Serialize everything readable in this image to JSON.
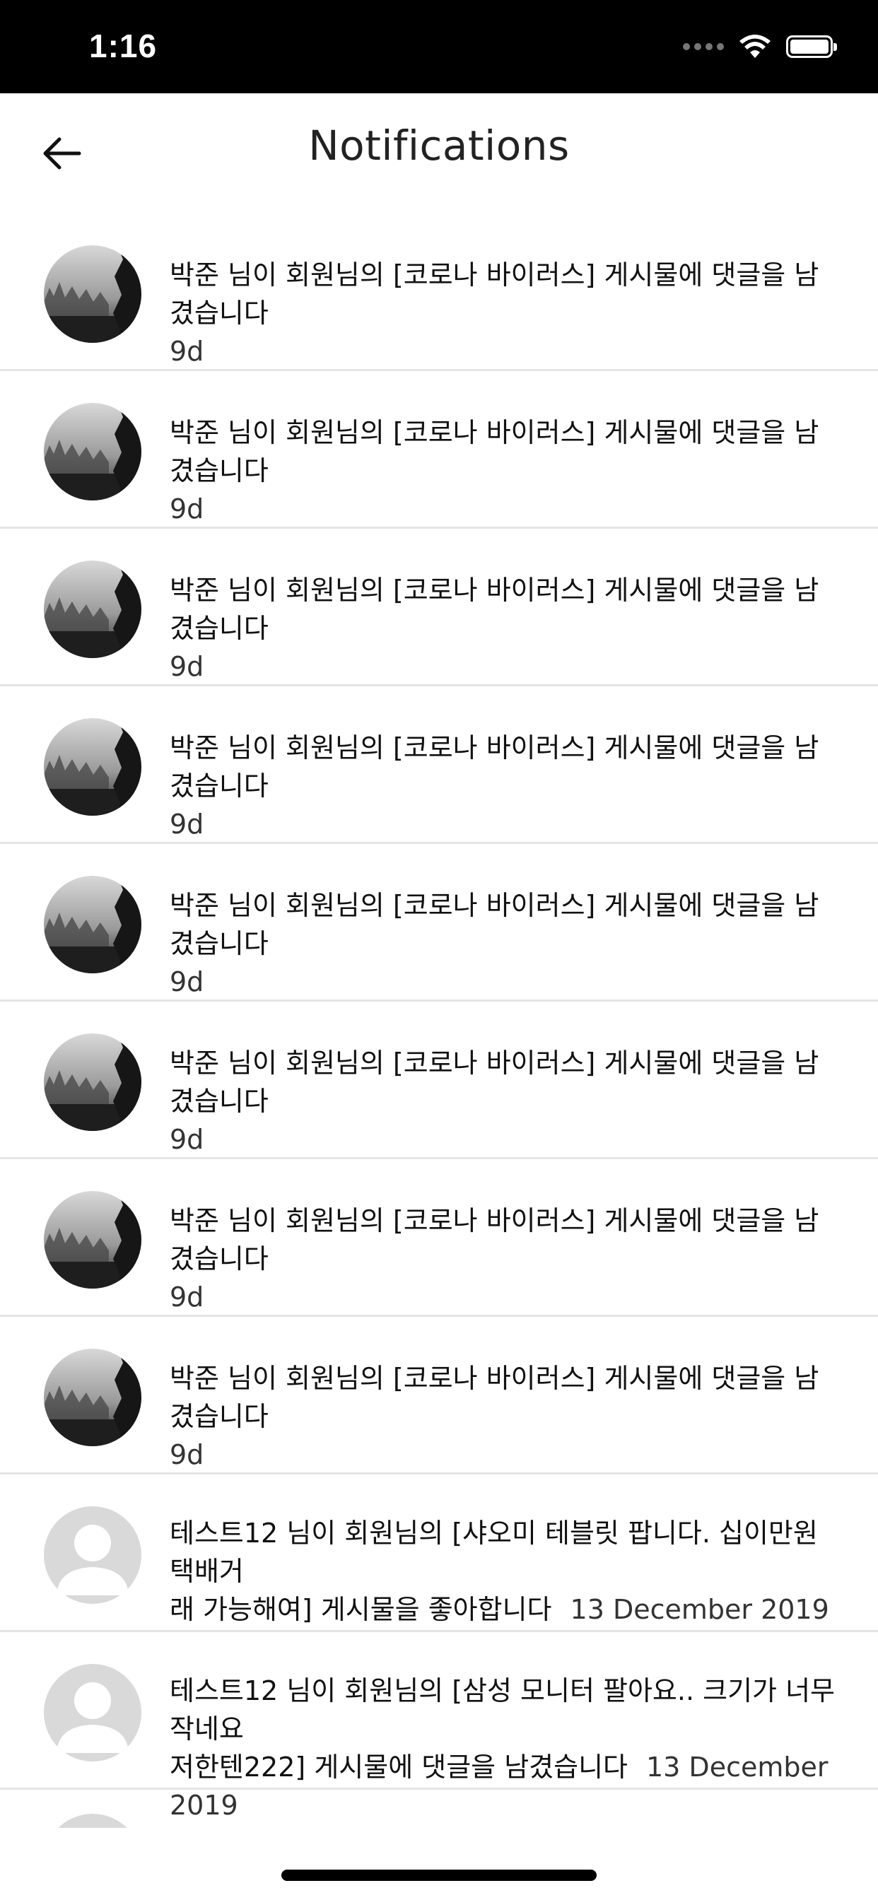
{
  "status_bar": {
    "time": "1:16"
  },
  "header": {
    "title": "Notifications"
  },
  "notifications": [
    {
      "text": "박준 님이 회원님의 [코로나 바이러스] 게시물에 댓글을 남겼습니다",
      "time": "9d",
      "avatar": "forest-photo"
    },
    {
      "text": "박준 님이 회원님의 [코로나 바이러스] 게시물에 댓글을 남겼습니다",
      "time": "9d",
      "avatar": "forest-photo"
    },
    {
      "text": "박준 님이 회원님의 [코로나 바이러스] 게시물에 댓글을 남겼습니다",
      "time": "9d",
      "avatar": "forest-photo"
    },
    {
      "text": "박준 님이 회원님의 [코로나 바이러스] 게시물에 댓글을 남겼습니다",
      "time": "9d",
      "avatar": "forest-photo"
    },
    {
      "text": "박준 님이 회원님의 [코로나 바이러스] 게시물에 댓글을 남겼습니다",
      "time": "9d",
      "avatar": "forest-photo"
    },
    {
      "text": "박준 님이 회원님의 [코로나 바이러스] 게시물에 댓글을 남겼습니다",
      "time": "9d",
      "avatar": "forest-photo"
    },
    {
      "text": "박준 님이 회원님의 [코로나 바이러스] 게시물에 댓글을 남겼습니다",
      "time": "9d",
      "avatar": "forest-photo"
    },
    {
      "text": "박준 님이 회원님의 [코로나 바이러스] 게시물에 댓글을 남겼습니다",
      "time": "9d",
      "avatar": "forest-photo"
    },
    {
      "text_line1": "테스트12 님이 회원님의 [샤오미 테블릿  팝니다. 십이만원 택배거",
      "text_line2": "래 가능해여] 게시물을 좋아합니다",
      "time": "13 December 2019",
      "avatar": "default-user"
    },
    {
      "text_line1": "테스트12 님이 회원님의 [삼성  모니터  팔아요.. 크기가 너무작네요",
      "text_line2": "저한텐222] 게시물에 댓글을 남겼습니다",
      "time": "13 December 2019",
      "avatar": "default-user"
    }
  ]
}
